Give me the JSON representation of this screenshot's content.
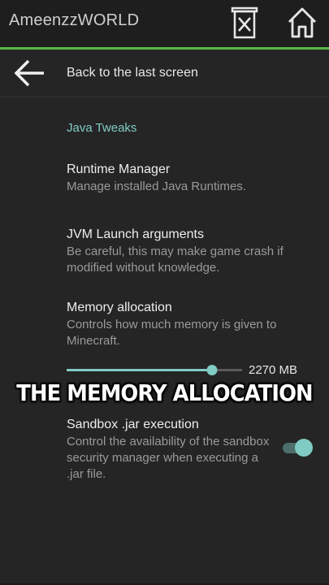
{
  "app": {
    "title": "AmeenzzWORLD"
  },
  "header": {
    "delete_icon": "delete-icon",
    "home_icon": "home-icon",
    "accent_color": "#57b846"
  },
  "back": {
    "label": "Back to the last screen",
    "icon": "back-arrow-icon"
  },
  "section": {
    "title": "Java Tweaks",
    "color": "#80cbc4"
  },
  "prefs": [
    {
      "title": "Runtime Manager",
      "summary": "Manage installed Java Runtimes."
    },
    {
      "title": "JVM Launch arguments",
      "summary": "Be careful, this may make game crash if modified without knowledge."
    },
    {
      "title": "Memory allocation",
      "summary": "Controls how much memory is given to Minecraft."
    },
    {
      "title": "Sandbox .jar execution",
      "summary": "Control the availability of the sandbox security manager when executing a .jar file."
    }
  ],
  "memory_slider": {
    "value_label": "2270 MB",
    "fill_fraction": 0.83
  },
  "sandbox_toggle": {
    "checked": true
  },
  "overlay": {
    "caption": "THE MEMORY ALLOCATION"
  }
}
